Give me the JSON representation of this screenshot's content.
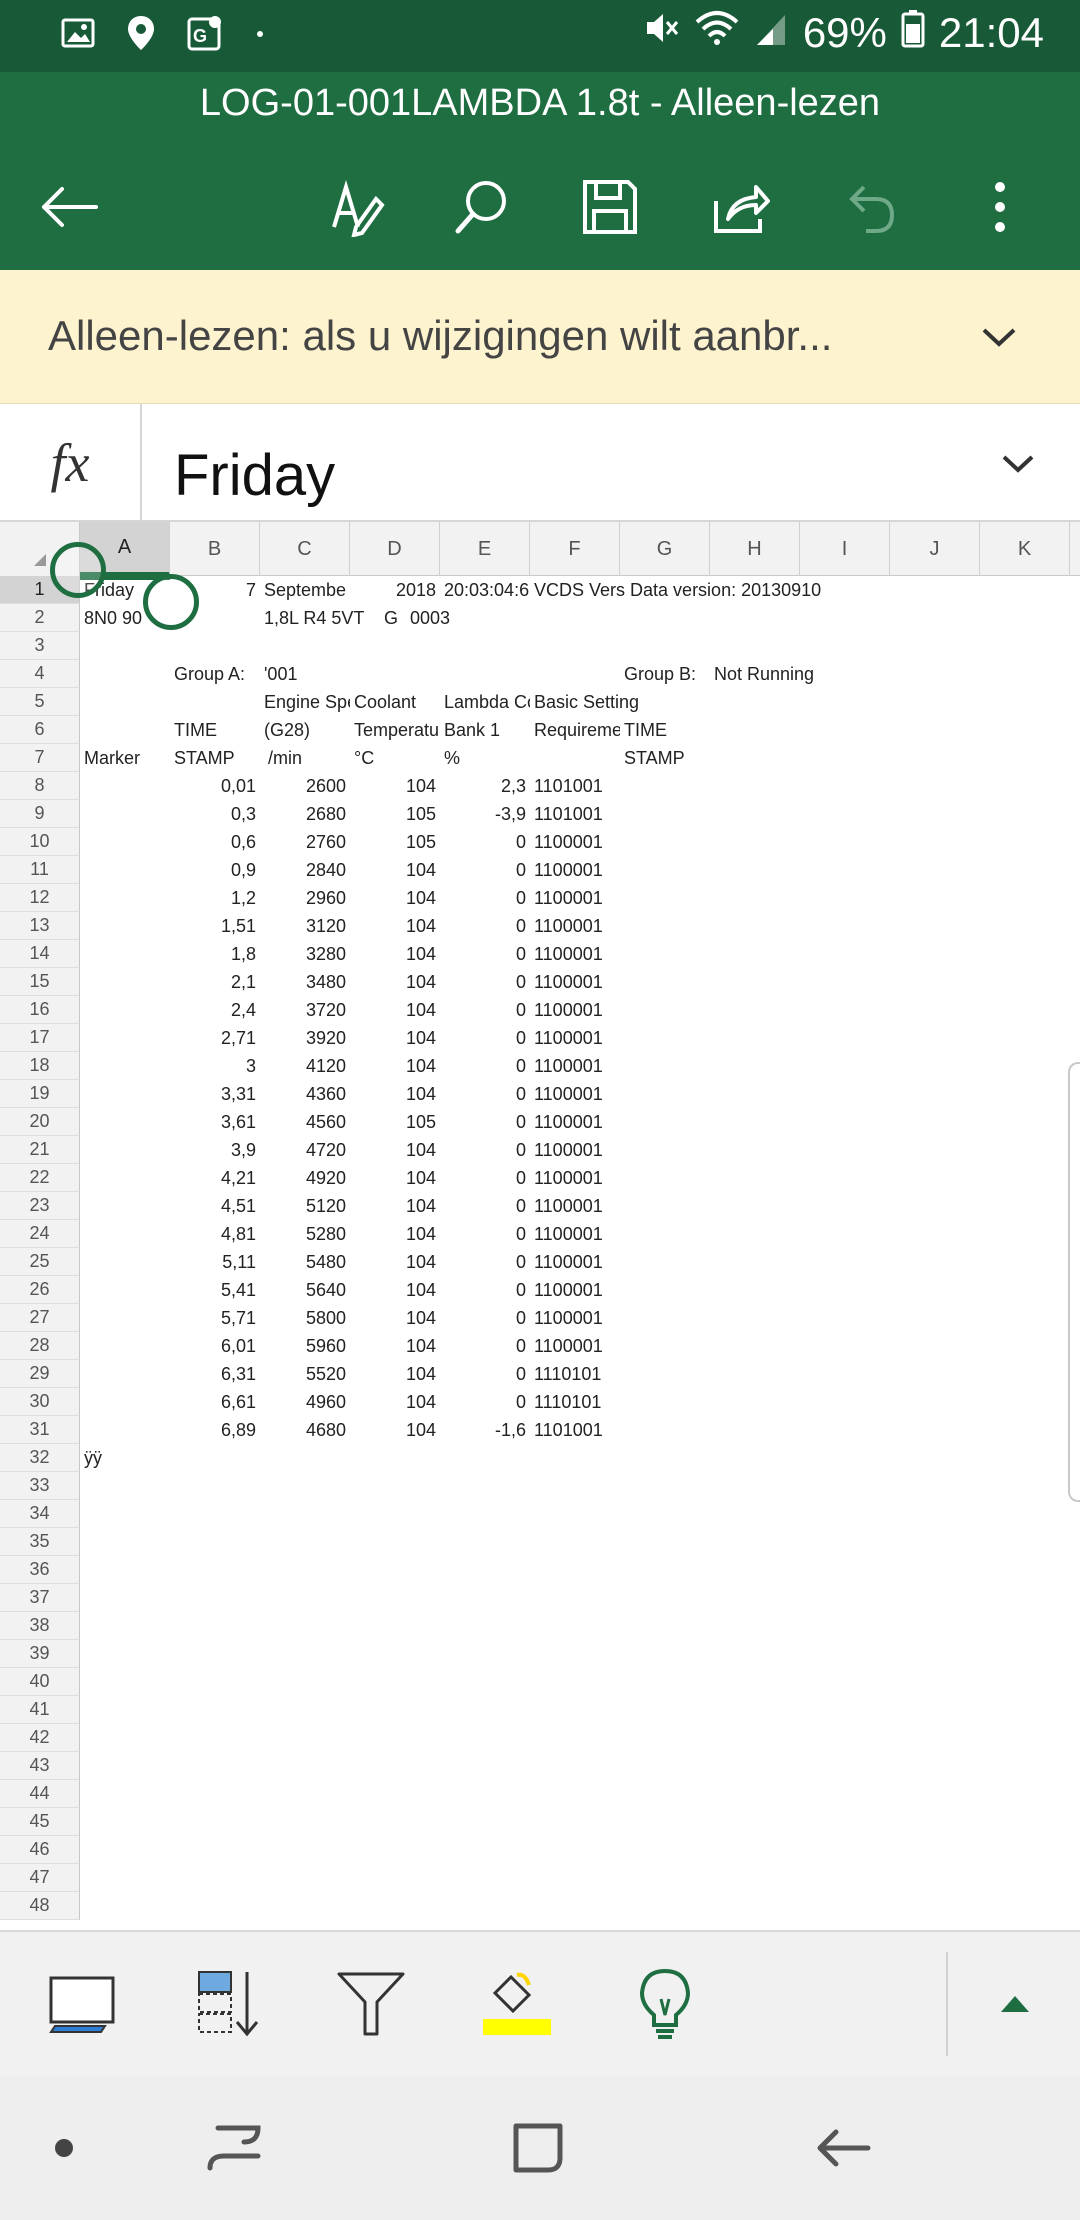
{
  "status_bar": {
    "battery": "69%",
    "time": "21:04",
    "icons": [
      "gallery-icon",
      "location-icon",
      "maps-icon",
      "dot-icon",
      "mute-icon",
      "wifi-icon",
      "signal-icon",
      "battery-icon"
    ]
  },
  "title_bar": {
    "title": "LOG-01-001LAMBDA 1.8t - Alleen-lezen",
    "actions": [
      "back-arrow-icon",
      "draw-pen-icon",
      "search-icon",
      "save-icon",
      "share-icon",
      "undo-icon",
      "more-icon"
    ]
  },
  "readonly_banner": {
    "text": "Alleen-lezen: als u wijzigingen wilt aanbr..."
  },
  "formula_bar": {
    "fx": "fx",
    "value": "Friday"
  },
  "sheet": {
    "columns": [
      "A",
      "B",
      "C",
      "D",
      "E",
      "F",
      "G",
      "H",
      "I",
      "J",
      "K"
    ],
    "rows": [
      "1",
      "2",
      "3",
      "4",
      "5",
      "6",
      "7",
      "8",
      "9",
      "10",
      "11",
      "12",
      "13",
      "14",
      "15",
      "16",
      "17",
      "18",
      "19",
      "20",
      "21",
      "22",
      "23",
      "24",
      "25",
      "26",
      "27",
      "28",
      "29",
      "30",
      "31",
      "32",
      "33",
      "34",
      "35",
      "36",
      "37",
      "38",
      "39",
      "40",
      "41",
      "42",
      "43",
      "44",
      "45",
      "46",
      "47",
      "48"
    ],
    "header_cells": {
      "r1a": "Friday",
      "r1b": "7",
      "r1c": "Septembe",
      "r1d": "2018",
      "r1e": "20:03:04:6",
      "r1f": "VCDS Vers Data version: 20130910",
      "r2a": "8N0 90",
      "r2c": "1,8L R4 5VT",
      "r2d": "G",
      "r2d2": "0003",
      "r4b": "Group A:",
      "r4c": "'001",
      "r4g": "Group B:",
      "r4h": "Not Running",
      "r5c": "Engine Spe",
      "r5d": "Coolant",
      "r5e": "Lambda Co",
      "r5f": "Basic Setting",
      "r6b": "TIME",
      "r6c": "(G28)",
      "r6d": "Temperatu",
      "r6e": "Bank 1",
      "r6f": "Requireme",
      "r6g": "TIME",
      "r7a": "Marker",
      "r7b": "STAMP",
      "r7c": "/min",
      "r7d": "°C",
      "r7e": "%",
      "r7g": "STAMP",
      "r32a": "ÿÿ"
    },
    "data_rows": [
      {
        "time": "0,01",
        "rpm": "2600",
        "temp": "104",
        "lambda": "2,3",
        "basic": "1101001"
      },
      {
        "time": "0,3",
        "rpm": "2680",
        "temp": "105",
        "lambda": "-3,9",
        "basic": "1101001"
      },
      {
        "time": "0,6",
        "rpm": "2760",
        "temp": "105",
        "lambda": "0",
        "basic": "1100001"
      },
      {
        "time": "0,9",
        "rpm": "2840",
        "temp": "104",
        "lambda": "0",
        "basic": "1100001"
      },
      {
        "time": "1,2",
        "rpm": "2960",
        "temp": "104",
        "lambda": "0",
        "basic": "1100001"
      },
      {
        "time": "1,51",
        "rpm": "3120",
        "temp": "104",
        "lambda": "0",
        "basic": "1100001"
      },
      {
        "time": "1,8",
        "rpm": "3280",
        "temp": "104",
        "lambda": "0",
        "basic": "1100001"
      },
      {
        "time": "2,1",
        "rpm": "3480",
        "temp": "104",
        "lambda": "0",
        "basic": "1100001"
      },
      {
        "time": "2,4",
        "rpm": "3720",
        "temp": "104",
        "lambda": "0",
        "basic": "1100001"
      },
      {
        "time": "2,71",
        "rpm": "3920",
        "temp": "104",
        "lambda": "0",
        "basic": "1100001"
      },
      {
        "time": "3",
        "rpm": "4120",
        "temp": "104",
        "lambda": "0",
        "basic": "1100001"
      },
      {
        "time": "3,31",
        "rpm": "4360",
        "temp": "104",
        "lambda": "0",
        "basic": "1100001"
      },
      {
        "time": "3,61",
        "rpm": "4560",
        "temp": "105",
        "lambda": "0",
        "basic": "1100001"
      },
      {
        "time": "3,9",
        "rpm": "4720",
        "temp": "104",
        "lambda": "0",
        "basic": "1100001"
      },
      {
        "time": "4,21",
        "rpm": "4920",
        "temp": "104",
        "lambda": "0",
        "basic": "1100001"
      },
      {
        "time": "4,51",
        "rpm": "5120",
        "temp": "104",
        "lambda": "0",
        "basic": "1100001"
      },
      {
        "time": "4,81",
        "rpm": "5280",
        "temp": "104",
        "lambda": "0",
        "basic": "1100001"
      },
      {
        "time": "5,11",
        "rpm": "5480",
        "temp": "104",
        "lambda": "0",
        "basic": "1100001"
      },
      {
        "time": "5,41",
        "rpm": "5640",
        "temp": "104",
        "lambda": "0",
        "basic": "1100001"
      },
      {
        "time": "5,71",
        "rpm": "5800",
        "temp": "104",
        "lambda": "0",
        "basic": "1100001"
      },
      {
        "time": "6,01",
        "rpm": "5960",
        "temp": "104",
        "lambda": "0",
        "basic": "1100001"
      },
      {
        "time": "6,31",
        "rpm": "5520",
        "temp": "104",
        "lambda": "0",
        "basic": "1110101"
      },
      {
        "time": "6,61",
        "rpm": "4960",
        "temp": "104",
        "lambda": "0",
        "basic": "1110101"
      },
      {
        "time": "6,89",
        "rpm": "4680",
        "temp": "104",
        "lambda": "-1,6",
        "basic": "1101001"
      }
    ]
  },
  "bottom_toolbar": {
    "tools": [
      "sheet-view-icon",
      "sort-icon",
      "filter-icon",
      "fill-color-icon",
      "lightbulb-icon",
      "expand-up-icon"
    ],
    "fill_color": "#ffff00",
    "accent_color": "#1e6e42"
  },
  "nav_bar": {
    "buttons": [
      "dot-button",
      "recents-button",
      "home-button",
      "back-button"
    ]
  }
}
